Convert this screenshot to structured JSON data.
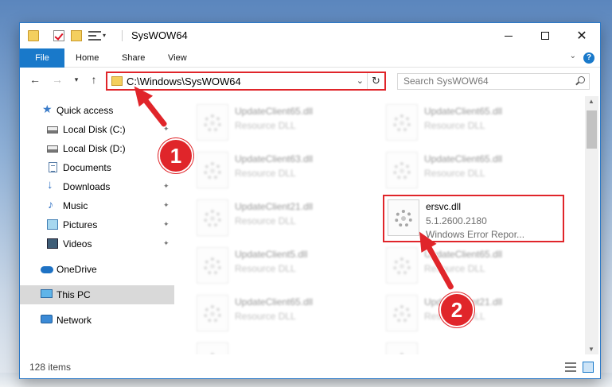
{
  "window": {
    "title": "SysWOW64",
    "quick_access_toolbar_dropdown": "▾",
    "minimize": "─",
    "maximize": "☐",
    "close": "✕"
  },
  "ribbon": {
    "tabs": [
      "File",
      "Home",
      "Share",
      "View"
    ],
    "expand_chevron": "⌄",
    "help": "?"
  },
  "navigation": {
    "back": "←",
    "forward": "→",
    "recent": "▾",
    "up": "↑"
  },
  "address_bar": {
    "path": "C:\\Windows\\SysWOW64",
    "dropdown": "⌄",
    "refresh": "↻"
  },
  "search": {
    "placeholder": "Search SysWOW64"
  },
  "sidebar": {
    "items": [
      {
        "label": "Quick access",
        "icon": "star-icon",
        "pinned": false
      },
      {
        "label": "Local Disk (C:)",
        "icon": "disk-icon",
        "pinned": true
      },
      {
        "label": "Local Disk (D:)",
        "icon": "disk-icon",
        "pinned": true
      },
      {
        "label": "Documents",
        "icon": "documents-icon",
        "pinned": true
      },
      {
        "label": "Downloads",
        "icon": "download-arrow-icon",
        "pinned": true
      },
      {
        "label": "Music",
        "icon": "music-note-icon",
        "pinned": true
      },
      {
        "label": "Pictures",
        "icon": "pictures-icon",
        "pinned": true
      },
      {
        "label": "Videos",
        "icon": "video-icon",
        "pinned": true
      },
      {
        "label": "OneDrive",
        "icon": "cloud-icon",
        "pinned": false
      },
      {
        "label": "This PC",
        "icon": "computer-icon",
        "pinned": false,
        "selected": true
      },
      {
        "label": "Network",
        "icon": "network-icon",
        "pinned": false
      }
    ]
  },
  "files": [
    {
      "name": "UpdateClient65.dll",
      "meta1": "Resource DLL",
      "meta2": "",
      "blurred": true
    },
    {
      "name": "UpdateClient65.dll",
      "meta1": "Resource DLL",
      "meta2": "",
      "blurred": true
    },
    {
      "name": "UpdateClient63.dll",
      "meta1": "Resource DLL",
      "meta2": "",
      "blurred": true
    },
    {
      "name": "UpdateClient65.dll",
      "meta1": "Resource DLL",
      "meta2": "",
      "blurred": true
    },
    {
      "name": "UpdateClient21.dll",
      "meta1": "Resource DLL",
      "meta2": "",
      "blurred": true
    },
    {
      "name": "ersvc.dll",
      "meta1": "5.1.2600.2180",
      "meta2": "Windows Error Repor...",
      "blurred": false
    },
    {
      "name": "UpdateClient5.dll",
      "meta1": "Resource DLL",
      "meta2": "",
      "blurred": true
    },
    {
      "name": "UpdateClient65.dll",
      "meta1": "Resource DLL",
      "meta2": "",
      "blurred": true
    },
    {
      "name": "UpdateClient65.dll",
      "meta1": "Resource DLL",
      "meta2": "",
      "blurred": true
    },
    {
      "name": "UpdateClient21.dll",
      "meta1": "Resource DLL",
      "meta2": "",
      "blurred": true
    },
    {
      "name": "",
      "meta1": "",
      "meta2": "",
      "blurred": true
    },
    {
      "name": "",
      "meta1": "",
      "meta2": "",
      "blurred": true
    }
  ],
  "status_bar": {
    "item_count": "128 items"
  },
  "annotations": {
    "badge_1": "1",
    "badge_2": "2",
    "color": "#e0252a"
  },
  "colors": {
    "accent": "#1979ca",
    "highlight": "#e0252a",
    "selected_nav": "#d9d9d9"
  }
}
